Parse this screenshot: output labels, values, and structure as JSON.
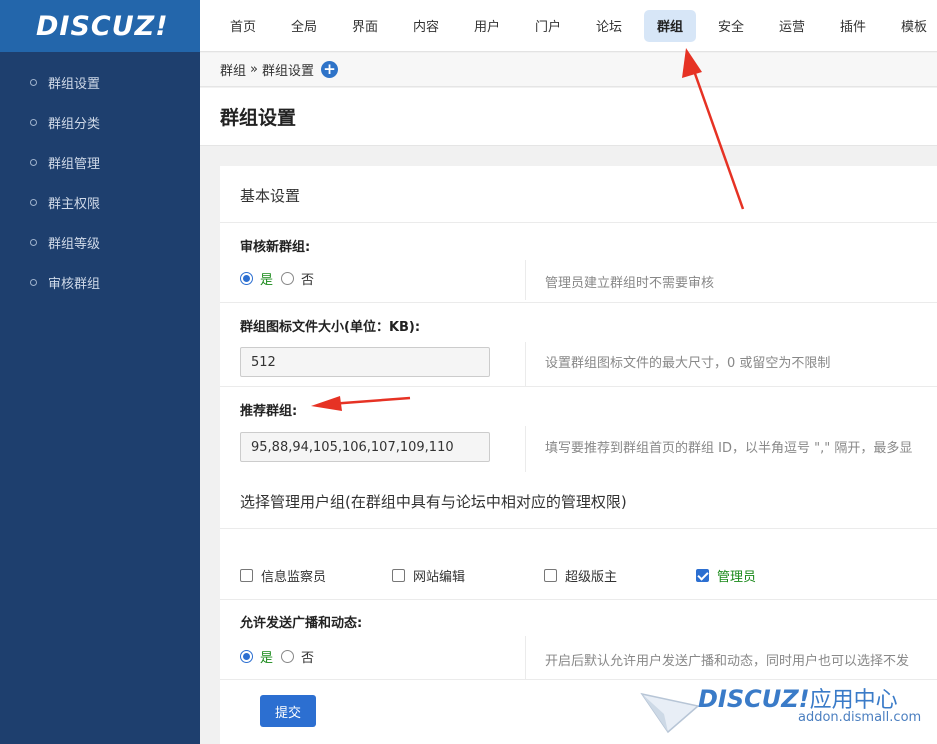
{
  "app": {
    "logo": "DISCUZ!"
  },
  "sidebar": {
    "items": [
      {
        "label": "群组设置"
      },
      {
        "label": "群组分类"
      },
      {
        "label": "群组管理"
      },
      {
        "label": "群主权限"
      },
      {
        "label": "群组等级"
      },
      {
        "label": "审核群组"
      }
    ]
  },
  "topnav": {
    "items": [
      {
        "label": "首页"
      },
      {
        "label": "全局"
      },
      {
        "label": "界面"
      },
      {
        "label": "内容"
      },
      {
        "label": "用户"
      },
      {
        "label": "门户"
      },
      {
        "label": "论坛"
      },
      {
        "label": "群组",
        "active": true
      },
      {
        "label": "安全"
      },
      {
        "label": "运营"
      },
      {
        "label": "插件"
      },
      {
        "label": "模板"
      }
    ]
  },
  "breadcrumb": {
    "root": "群组",
    "sep": "»",
    "current": "群组设置",
    "add_icon": "+"
  },
  "page": {
    "title": "群组设置"
  },
  "basic": {
    "section_title": "基本设置",
    "audit": {
      "label": "审核新群组:",
      "yes": "是",
      "no": "否",
      "selected": "no-audit-yes",
      "tip": "管理员建立群组时不需要审核"
    },
    "icon_size": {
      "label": "群组图标文件大小(单位：KB):",
      "value": "512",
      "tip": "设置群组图标文件的最大尺寸，0 或留空为不限制"
    },
    "recommend": {
      "label": "推荐群组:",
      "value": "95,88,94,105,106,107,109,110",
      "tip": "填写要推荐到群组首页的群组 ID，以半角逗号 \",\" 隔开，最多显"
    }
  },
  "managers": {
    "section_title": "选择管理用户组(在群组中具有与论坛中相对应的管理权限)",
    "groups": [
      {
        "label": "信息监察员",
        "checked": false
      },
      {
        "label": "网站编辑",
        "checked": false
      },
      {
        "label": "超级版主",
        "checked": false
      },
      {
        "label": "管理员",
        "checked": true
      }
    ]
  },
  "broadcast": {
    "label": "允许发送广播和动态:",
    "yes": "是",
    "no": "否",
    "tip": "开启后默认允许用户发送广播和动态，同时用户也可以选择不发"
  },
  "actions": {
    "submit": "提交"
  },
  "watermark": {
    "logo": "DISCUZ!",
    "cn": "应用中心",
    "url": "addon.dismall.com"
  },
  "colors": {
    "sidebar_bg": "#1e3f6e",
    "logo_bg": "#2366ab",
    "accent": "#2c6fd1",
    "annotation": "#e63224"
  }
}
